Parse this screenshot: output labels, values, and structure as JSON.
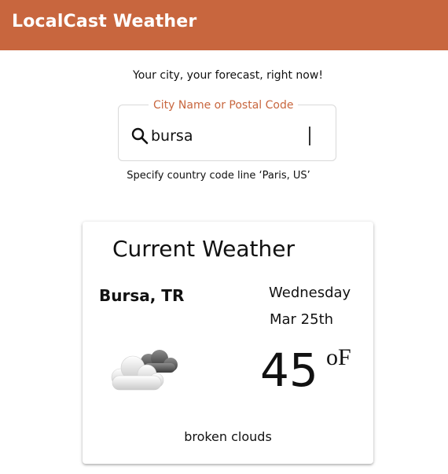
{
  "app": {
    "title": "LocalCast Weather"
  },
  "colors": {
    "brand": "#c8663e",
    "accent": "#c8663e"
  },
  "search": {
    "tagline": "Your city, your forecast, right now!",
    "label": "City Name or Postal Code",
    "value": "bursa",
    "hint": "Specify country code line ‘Paris, US’",
    "icon": "search-icon"
  },
  "current": {
    "card_title": "Current Weather",
    "city": "Bursa, TR",
    "day": "Wednesday",
    "date": "Mar 25th",
    "temperature": "45",
    "unit": "oF",
    "description": "broken clouds",
    "icon": "broken-clouds-icon"
  }
}
